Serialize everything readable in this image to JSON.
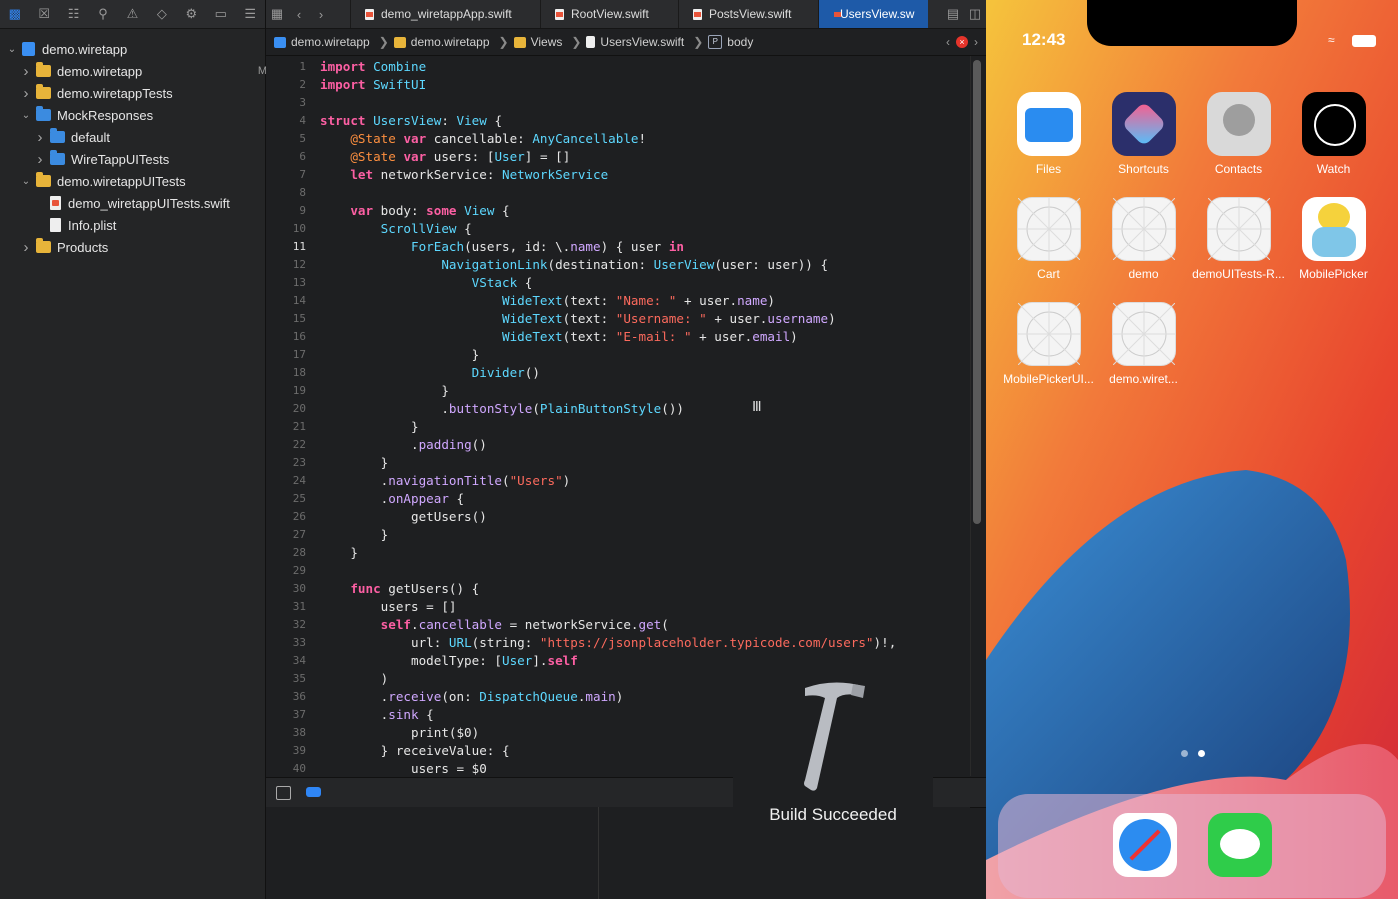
{
  "navigator": {
    "toolbar_icons": [
      "folder-icon",
      "source-control-icon",
      "hierarchy-icon",
      "search-icon",
      "warning-icon",
      "test-icon",
      "debug-icon",
      "breakpoint-icon",
      "report-icon"
    ],
    "tree": [
      {
        "label": "demo.wiretapp",
        "kind": "project",
        "depth": 0,
        "open": true
      },
      {
        "label": "demo.wiretapp",
        "kind": "folder-yellow",
        "depth": 1,
        "open": false,
        "badge": "M"
      },
      {
        "label": "demo.wiretappTests",
        "kind": "folder-yellow",
        "depth": 1,
        "open": false
      },
      {
        "label": "MockResponses",
        "kind": "folder-blue",
        "depth": 1,
        "open": true
      },
      {
        "label": "default",
        "kind": "folder-blue",
        "depth": 2,
        "open": false
      },
      {
        "label": "WireTappUITests",
        "kind": "folder-blue",
        "depth": 2,
        "open": false
      },
      {
        "label": "demo.wiretappUITests",
        "kind": "folder-yellow",
        "depth": 1,
        "open": true
      },
      {
        "label": "demo_wiretappUITests.swift",
        "kind": "swift",
        "depth": 2
      },
      {
        "label": "Info.plist",
        "kind": "plist",
        "depth": 2
      },
      {
        "label": "Products",
        "kind": "folder-yellow",
        "depth": 1,
        "open": false
      }
    ]
  },
  "tabs": [
    {
      "label": "demo_wiretappApp.swift",
      "active": false
    },
    {
      "label": "RootView.swift",
      "active": false
    },
    {
      "label": "PostsView.swift",
      "active": false
    },
    {
      "label": "UsersView.sw",
      "active": true
    }
  ],
  "breadcrumb": [
    "demo.wiretapp",
    "demo.wiretapp",
    "Views",
    "UsersView.swift",
    "body"
  ],
  "code": {
    "current_line": 11,
    "lines": [
      "import Combine",
      "import SwiftUI",
      "",
      "struct UsersView: View {",
      "    @State var cancellable: AnyCancellable!",
      "    @State var users: [User] = []",
      "    let networkService: NetworkService",
      "",
      "    var body: some View {",
      "        ScrollView {",
      "            ForEach(users, id: \\.name) { user in",
      "                NavigationLink(destination: UserView(user: user)) {",
      "                    VStack {",
      "                        WideText(text: \"Name: \" + user.name)",
      "                        WideText(text: \"Username: \" + user.username)",
      "                        WideText(text: \"E-mail: \" + user.email)",
      "                    }",
      "                    Divider()",
      "                }",
      "                .buttonStyle(PlainButtonStyle())",
      "            }",
      "            .padding()",
      "        }",
      "        .navigationTitle(\"Users\")",
      "        .onAppear {",
      "            getUsers()",
      "        }",
      "    }",
      "",
      "    func getUsers() {",
      "        users = []",
      "        self.cancellable = networkService.get(",
      "            url: URL(string: \"https://jsonplaceholder.typicode.com/users\")!,",
      "            modelType: [User].self",
      "        )",
      "        .receive(on: DispatchQueue.main)",
      "        .sink {",
      "            print($0)",
      "        } receiveValue: {",
      "            users = $0"
    ]
  },
  "hud": {
    "text": "Build Succeeded"
  },
  "simulator": {
    "time": "12:43",
    "apps": [
      {
        "label": "Files",
        "icon": "files-icon"
      },
      {
        "label": "Shortcuts",
        "icon": "shortcuts-icon"
      },
      {
        "label": "Contacts",
        "icon": "contacts-icon"
      },
      {
        "label": "Watch",
        "icon": "watch-icon"
      },
      {
        "label": "Cart",
        "icon": "placeholder-app-icon"
      },
      {
        "label": "demo",
        "icon": "placeholder-app-icon"
      },
      {
        "label": "demoUITests-R...",
        "icon": "placeholder-app-icon"
      },
      {
        "label": "MobilePicker",
        "icon": "cartoon-app-icon"
      },
      {
        "label": "MobilePickerUI...",
        "icon": "placeholder-app-icon"
      },
      {
        "label": "demo.wiret...",
        "icon": "placeholder-app-icon"
      }
    ],
    "dock": [
      {
        "label": "",
        "icon": "safari-icon"
      },
      {
        "label": "",
        "icon": "messages-icon"
      }
    ]
  }
}
